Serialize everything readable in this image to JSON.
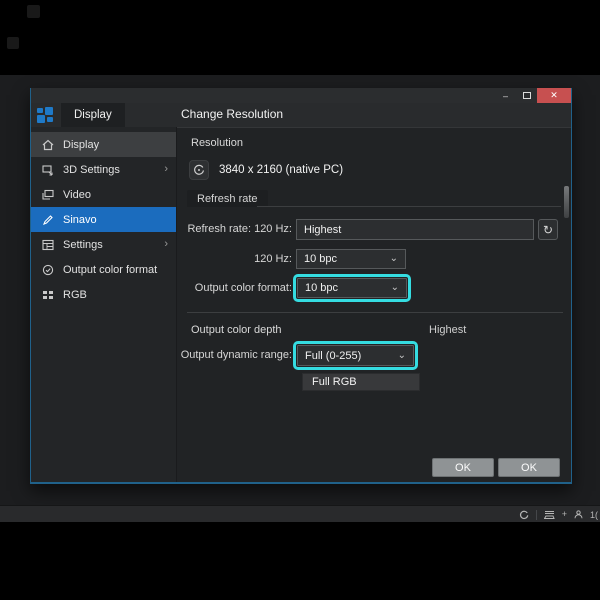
{
  "window": {
    "tab_label": "Display",
    "page_title": "Change Resolution",
    "titlebar": {
      "minimize": "–",
      "close": "✕"
    }
  },
  "sidebar": {
    "items": [
      {
        "label": "Display",
        "icon": "home-icon",
        "state": "hovered"
      },
      {
        "label": "3D Settings",
        "icon": "3d-settings-icon",
        "chevron": "›"
      },
      {
        "label": "Video",
        "icon": "video-icon"
      },
      {
        "label": "Sinavo",
        "icon": "pencil-icon",
        "state": "selected"
      },
      {
        "label": "Settings",
        "icon": "settings-icon",
        "chevron": "›"
      },
      {
        "label": "Output color format",
        "icon": "check-circle-icon"
      },
      {
        "label": "RGB",
        "icon": "grid-icon"
      }
    ]
  },
  "content": {
    "resolution_section_label": "Resolution",
    "resolution_value": "3840 x 2160 (native PC)",
    "refresh_header": "Refresh rate",
    "refresh_row_label": "Refresh rate: 120 Hz:",
    "refresh_row_value": "Highest",
    "hz_row_label": "120 Hz:",
    "hz_row_value": "10 bpc",
    "format_row_label": "Output color format:",
    "format_row_value": "10 bpc",
    "depth_label": "Output color depth",
    "depth_value": "Highest",
    "range_row_label": "Output dynamic range:",
    "range_row_value": "Full (0-255)",
    "dropdown_open_item": "Full RGB",
    "ok_primary": "OK",
    "ok_secondary": "OK"
  },
  "icons": {
    "chevron_down": "⌄",
    "refresh": "↻",
    "plus": "+"
  },
  "taskbar": {
    "tray_icon_names": [
      "gpu-swirl-icon",
      "tray-lines-icon",
      "plus-icon",
      "person-icon"
    ],
    "clipped_text": "1("
  },
  "colors": {
    "accent_cyan": "#35dce1",
    "selection_blue": "#1b6cbe",
    "window_border_blue": "#20618a",
    "close_red": "#c75050",
    "desktop": "#1c1d1f"
  }
}
